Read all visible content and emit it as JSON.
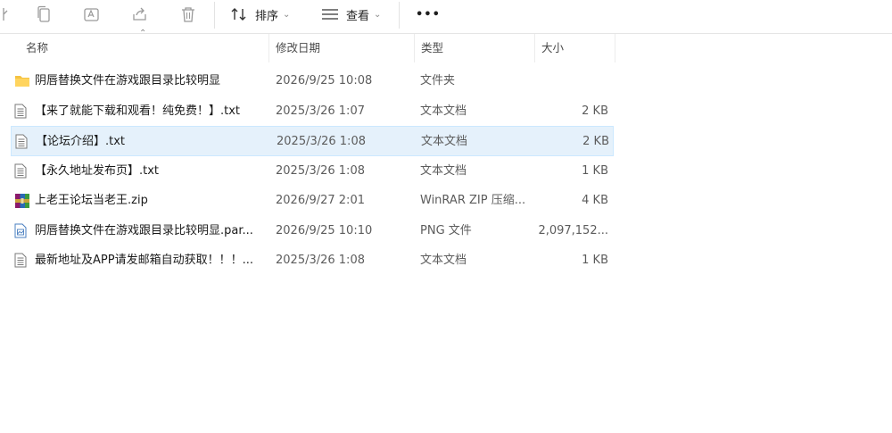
{
  "toolbar": {
    "sort_label": "排序",
    "view_label": "查看",
    "more_label": "•••"
  },
  "columns": {
    "name": "名称",
    "date": "修改日期",
    "type": "类型",
    "size": "大小"
  },
  "files": [
    {
      "name": "阴唇替换文件在游戏跟目录比较明显",
      "date": "2026/9/25 10:08",
      "type": "文件夹",
      "size": "",
      "icon": "folder-icon"
    },
    {
      "name": "【来了就能下载和观看！纯免费！】.txt",
      "date": "2025/3/26 1:07",
      "type": "文本文档",
      "size": "2 KB",
      "icon": "text-file-icon"
    },
    {
      "name": "【论坛介绍】.txt",
      "date": "2025/3/26 1:08",
      "type": "文本文档",
      "size": "2 KB",
      "icon": "text-file-icon"
    },
    {
      "name": "【永久地址发布页】.txt",
      "date": "2025/3/26 1:08",
      "type": "文本文档",
      "size": "1 KB",
      "icon": "text-file-icon"
    },
    {
      "name": "上老王论坛当老王.zip",
      "date": "2026/9/27 2:01",
      "type": "WinRAR ZIP 压缩...",
      "size": "4 KB",
      "icon": "winrar-archive-icon"
    },
    {
      "name": "阴唇替换文件在游戏跟目录比较明显.par...",
      "date": "2026/9/25 10:10",
      "type": "PNG 文件",
      "size": "2,097,152...",
      "icon": "image-file-icon"
    },
    {
      "name": "最新地址及APP请发邮箱自动获取！！！...",
      "date": "2025/3/26 1:08",
      "type": "文本文档",
      "size": "1 KB",
      "icon": "text-file-icon"
    }
  ],
  "selected_index": 2,
  "colors": {
    "selection_bg": "#e5f1fb",
    "selection_border": "#cce8ff",
    "folder": "#f5c342"
  }
}
